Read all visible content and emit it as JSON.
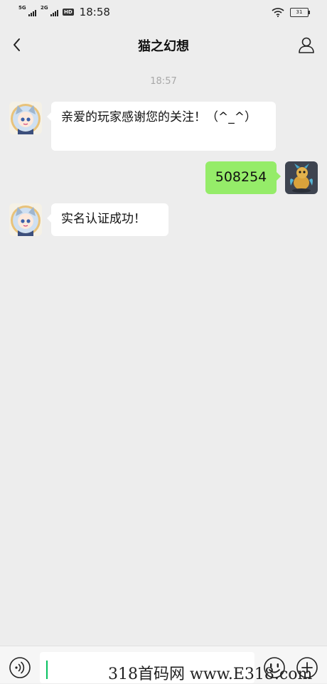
{
  "status_bar": {
    "network1": "5G",
    "network2": "2G",
    "hd_label": "HD",
    "time": "18:58",
    "battery": "31"
  },
  "header": {
    "title": "猫之幻想",
    "back_icon": "chevron-left-icon",
    "profile_icon": "person-icon"
  },
  "chat": {
    "timestamp": "18:57",
    "messages": [
      {
        "side": "in",
        "text": "亲爱的玩家感谢您的关注！（^_^）"
      },
      {
        "side": "out",
        "text": "508254"
      },
      {
        "side": "in",
        "text": "实名认证成功！"
      }
    ]
  },
  "input_bar": {
    "voice_icon": "voice-icon",
    "emoji_icon": "emoji-icon",
    "plus_icon": "plus-circle-icon",
    "value": ""
  },
  "watermark": "318首码网 www.E318.com",
  "colors": {
    "background": "#ededed",
    "outgoing_bubble": "#95ec69",
    "incoming_bubble": "#ffffff",
    "caret": "#07c160"
  }
}
